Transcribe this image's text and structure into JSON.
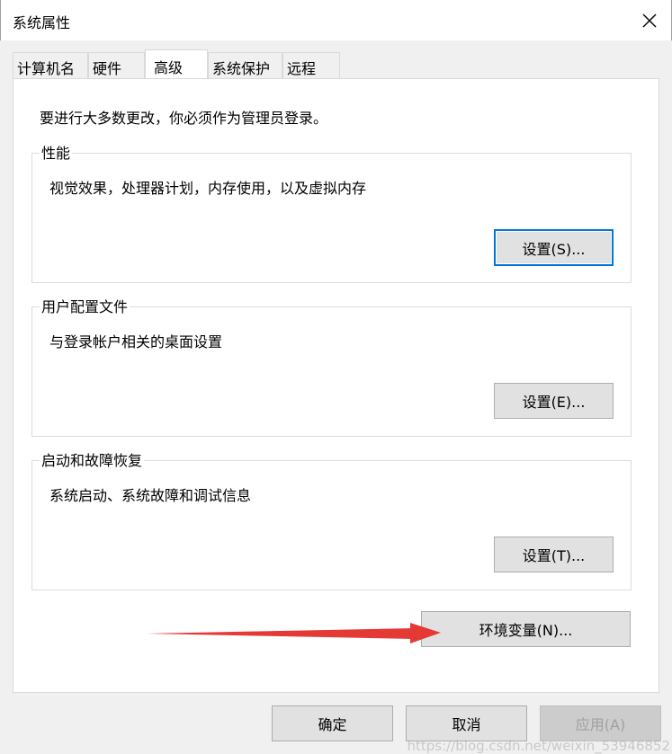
{
  "window": {
    "title": "系统属性",
    "close_icon": "close-icon"
  },
  "tabs": [
    {
      "label": "计算机名",
      "active": false
    },
    {
      "label": "硬件",
      "active": false
    },
    {
      "label": "高级",
      "active": true
    },
    {
      "label": "系统保护",
      "active": false
    },
    {
      "label": "远程",
      "active": false
    }
  ],
  "advanced": {
    "admin_notice": "要进行大多数更改，你必须作为管理员登录。",
    "performance": {
      "label": "性能",
      "description": "视觉效果，处理器计划，内存使用，以及虚拟内存",
      "settings_button": "设置(S)..."
    },
    "user_profiles": {
      "label": "用户配置文件",
      "description": "与登录帐户相关的桌面设置",
      "settings_button": "设置(E)..."
    },
    "startup_recovery": {
      "label": "启动和故障恢复",
      "description": "系统启动、系统故障和调试信息",
      "settings_button": "设置(T)..."
    },
    "env_button": "环境变量(N)..."
  },
  "footer": {
    "ok": "确定",
    "cancel": "取消",
    "apply": "应用(A)"
  },
  "watermark": "https://blog.csdn.net/weixin_53946852",
  "colors": {
    "focus_border": "#0078d7",
    "annotation_arrow": "#e53935"
  }
}
